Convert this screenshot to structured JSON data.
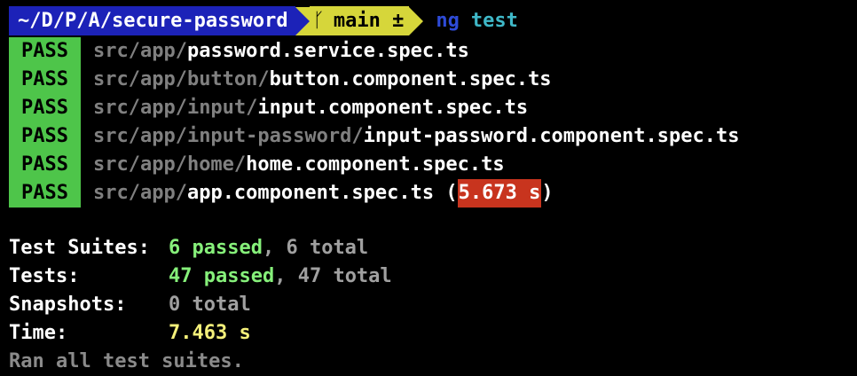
{
  "prompt": {
    "path": "~/D/P/A/secure-password",
    "branch_icon": "ᚴ",
    "branch": "main ±",
    "command": "ng",
    "command_arg": "test"
  },
  "results": [
    {
      "status": "PASS",
      "dir": "src/app/",
      "file": "password.service.spec.ts"
    },
    {
      "status": "PASS",
      "dir": "src/app/button/",
      "file": "button.component.spec.ts"
    },
    {
      "status": "PASS",
      "dir": "src/app/input/",
      "file": "input.component.spec.ts"
    },
    {
      "status": "PASS",
      "dir": "src/app/input-password/",
      "file": "input-password.component.spec.ts"
    },
    {
      "status": "PASS",
      "dir": "src/app/home/",
      "file": "home.component.spec.ts"
    },
    {
      "status": "PASS",
      "dir": "src/app/",
      "file": "app.component.spec.ts",
      "open": " (",
      "time": "5.673 s",
      "close": ")"
    }
  ],
  "summary": {
    "suites_label": "Test Suites:",
    "suites_passed": "6 passed",
    "suites_total": ", 6 total",
    "tests_label": "Tests:",
    "tests_passed": "47 passed",
    "tests_total": ", 47 total",
    "snapshots_label": "Snapshots:",
    "snapshots_total": "0 total",
    "time_label": "Time:",
    "time_value": "7.463 s",
    "footer": "Ran all test suites."
  },
  "colors": {
    "background": "#000000",
    "pass_badge": "#4ec54a",
    "path_segment": "#1c22b8",
    "git_segment": "#d6d63a",
    "slow_time": "#c8341e"
  }
}
